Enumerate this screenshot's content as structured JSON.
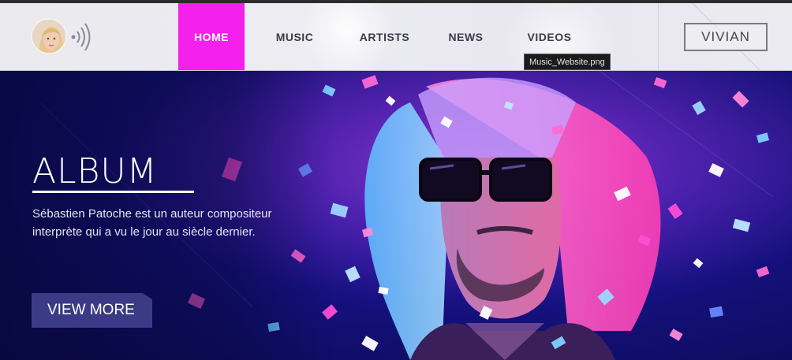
{
  "header": {
    "nav": [
      {
        "label": "HOME",
        "active": true
      },
      {
        "label": "MUSIC",
        "active": false
      },
      {
        "label": "ARTISTS",
        "active": false
      },
      {
        "label": "NEWS",
        "active": false
      },
      {
        "label": "VIDEOS",
        "active": false
      }
    ],
    "user_label": "VIVIAN",
    "tooltip": "Music_Website.png",
    "icons": [
      "avatar",
      "sound-icon"
    ]
  },
  "hero": {
    "title": "ALBUM",
    "description": "Sébastien Patoche est un auteur compositeur interprète qui a vu le jour au siècle dernier.",
    "cta_label": "VIEW MORE"
  },
  "colors": {
    "accent": "#f420ec",
    "header_bg": "#ececf2",
    "hero_bg": "#14107a",
    "cta_bg": "#3a3a86"
  }
}
